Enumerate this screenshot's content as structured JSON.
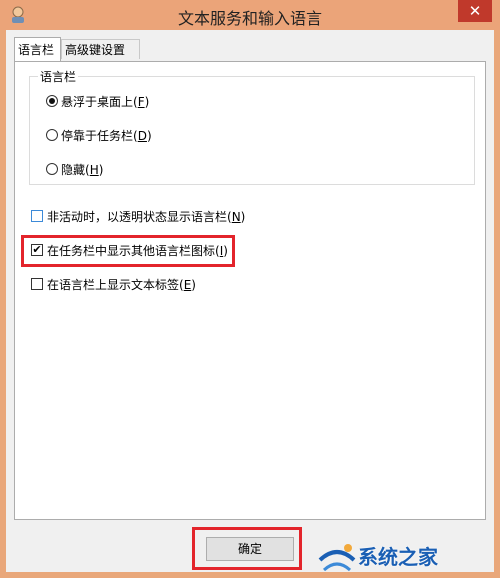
{
  "window": {
    "title": "文本服务和输入语言",
    "close_glyph": "✕"
  },
  "tabs": [
    {
      "label": "语言栏",
      "active": true
    },
    {
      "label": "高级键设置",
      "active": false
    }
  ],
  "language_bar_group": {
    "legend": "语言栏",
    "options": [
      {
        "label": "悬浮于桌面上(",
        "hotkey": "F",
        "suffix": ")",
        "selected": true
      },
      {
        "label": "停靠于任务栏(",
        "hotkey": "D",
        "suffix": ")",
        "selected": false
      },
      {
        "label": "隐藏(",
        "hotkey": "H",
        "suffix": ")",
        "selected": false
      }
    ]
  },
  "checkboxes": [
    {
      "label": "非活动时，以透明状态显示语言栏(",
      "hotkey": "N",
      "suffix": ")",
      "checked": false
    },
    {
      "label": "在任务栏中显示其他语言栏图标(",
      "hotkey": "I",
      "suffix": ")",
      "checked": true
    },
    {
      "label": "在语言栏上显示文本标签(",
      "hotkey": "E",
      "suffix": ")",
      "checked": false
    }
  ],
  "buttons": {
    "ok_label": "确定"
  },
  "watermark": {
    "text": "系统之家"
  },
  "colors": {
    "titlebar": "#eba479",
    "highlight": "#e3242b",
    "close": "#c0392b"
  }
}
